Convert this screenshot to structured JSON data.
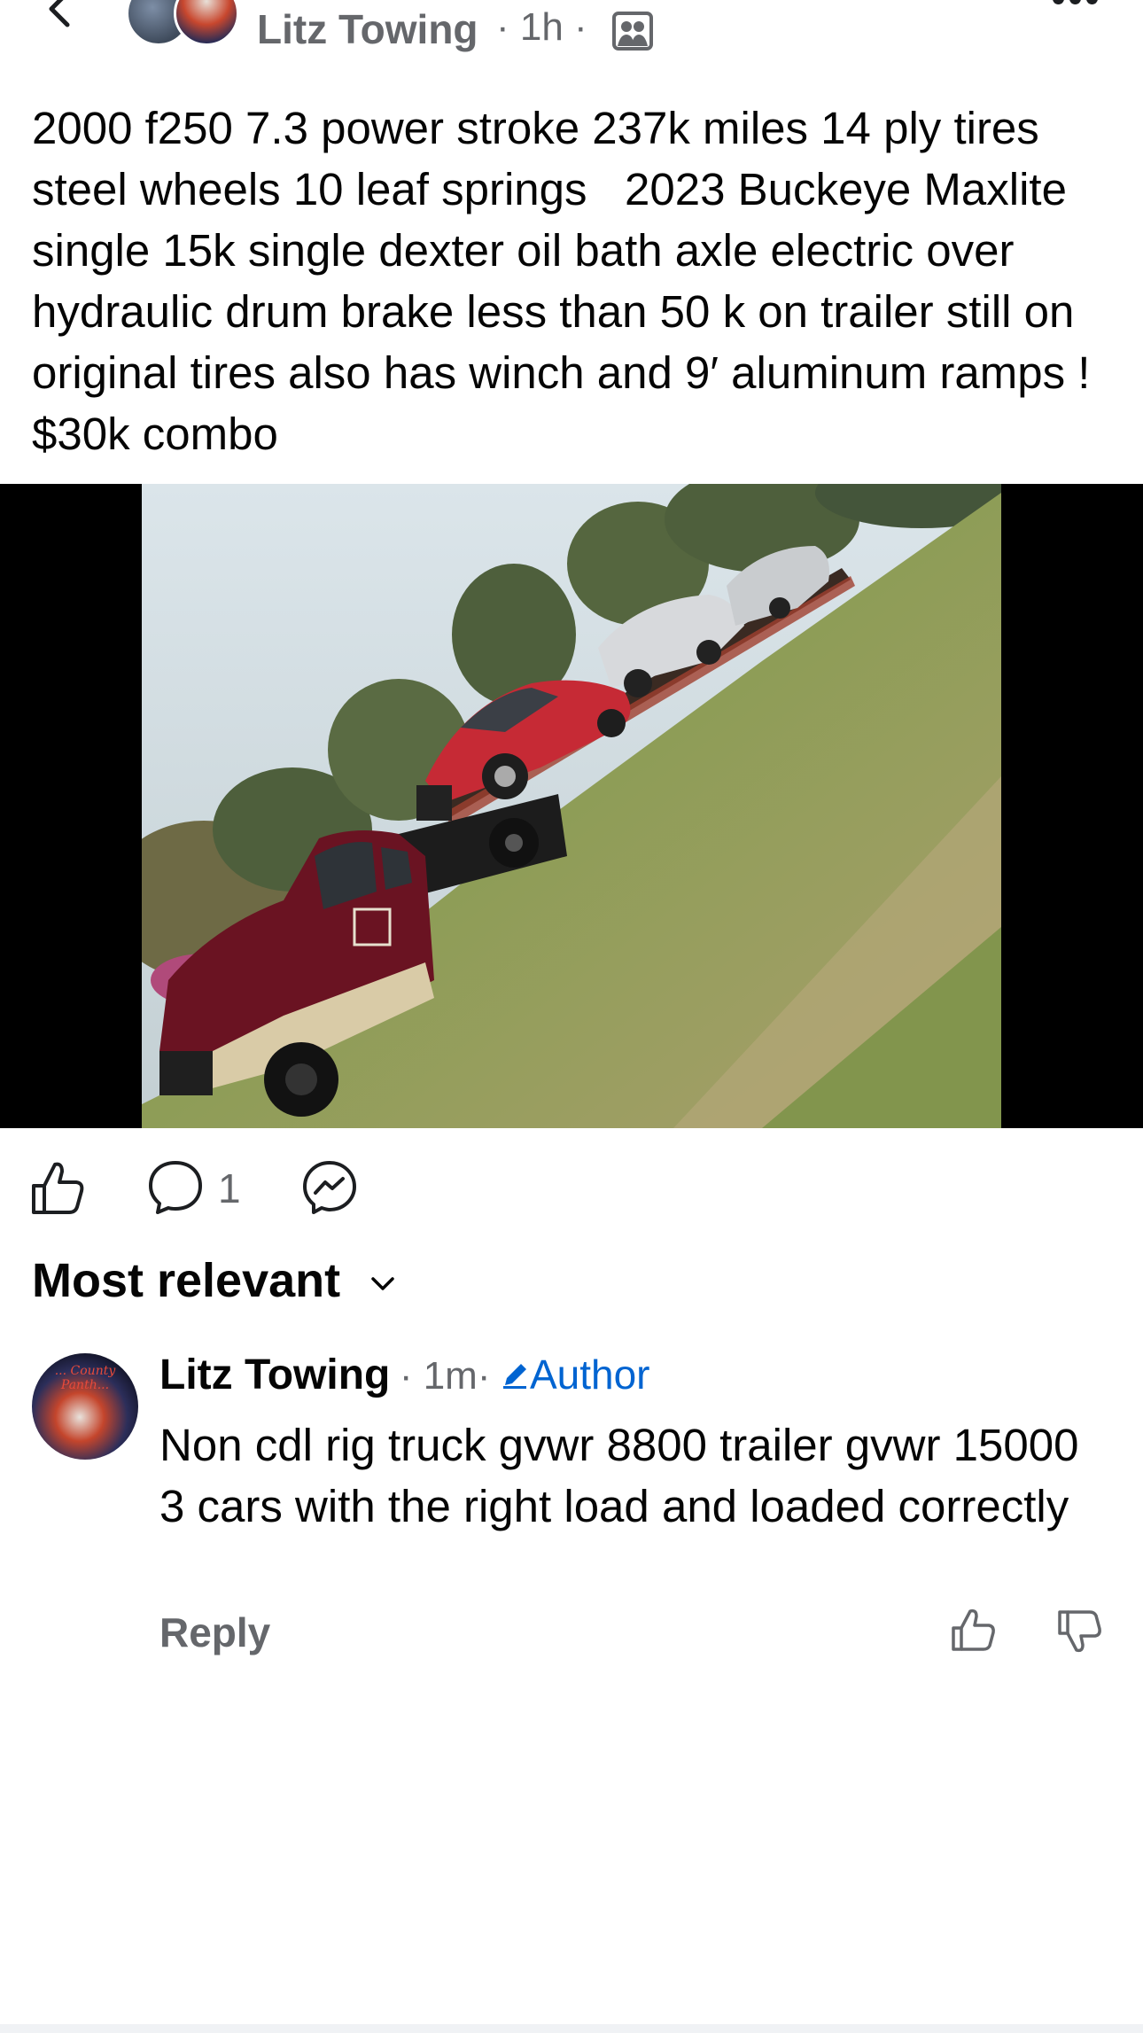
{
  "header": {
    "author_name": "Litz Towing",
    "meta": "· 1h ·",
    "group_icon": "group-privacy-icon",
    "back_icon": "chevron-left-icon",
    "more_icon": "more-horizontal-icon"
  },
  "post": {
    "text": "2000 f250 7.3 power stroke 237k miles 14 ply tires steel wheels 10 leaf springs   2023 Buckeye Maxlite  single 15k single dexter oil bath axle electric over hydraulic drum brake less than 50 k on trailer still on original tires also has winch and 9′ aluminum ramps ! $30k combo"
  },
  "actions": {
    "like_icon": "thumbs-up-icon",
    "comment_icon": "comment-bubble-icon",
    "comment_count": "1",
    "share_icon": "messenger-icon"
  },
  "comments_section": {
    "sort_label": "Most relevant"
  },
  "comment": {
    "author": "Litz Towing",
    "time": "· 1m·",
    "badge": "Author",
    "text": "Non cdl rig truck gvwr 8800 trailer gvwr 15000 3 cars with the right load and loaded correctly",
    "reply_label": "Reply",
    "avatar_caption": "... County Panth..."
  },
  "colors": {
    "text_primary": "#050505",
    "text_secondary": "#65676b",
    "author_badge": "#0064d1"
  }
}
